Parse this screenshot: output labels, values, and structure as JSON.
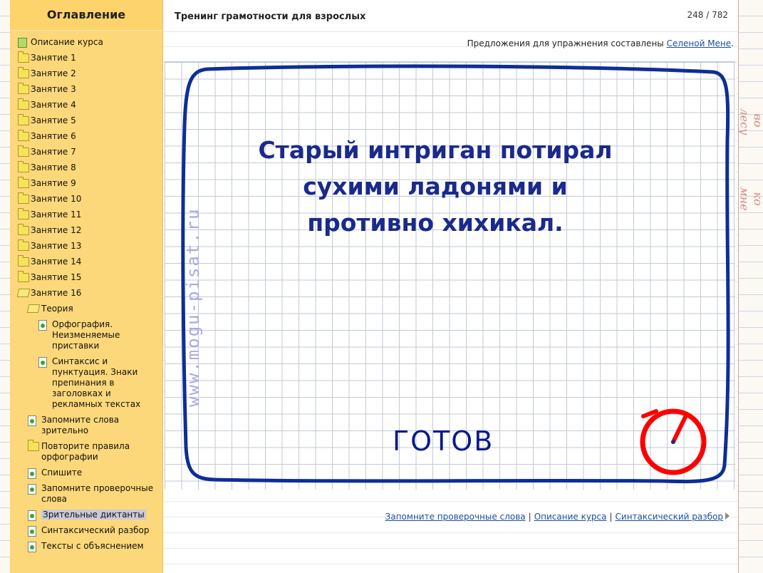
{
  "sidebar": {
    "title": "Оглавление",
    "items": [
      {
        "label": "Описание курса",
        "icon": "course-icon",
        "level": 1
      },
      {
        "label": "Занятие 1",
        "icon": "folder-icon",
        "level": 1
      },
      {
        "label": "Занятие 2",
        "icon": "folder-icon",
        "level": 1
      },
      {
        "label": "Занятие 3",
        "icon": "folder-icon",
        "level": 1
      },
      {
        "label": "Занятие 4",
        "icon": "folder-icon",
        "level": 1
      },
      {
        "label": "Занятие 5",
        "icon": "folder-icon",
        "level": 1
      },
      {
        "label": "Занятие 6",
        "icon": "folder-icon",
        "level": 1
      },
      {
        "label": "Занятие 7",
        "icon": "folder-icon",
        "level": 1
      },
      {
        "label": "Занятие 8",
        "icon": "folder-icon",
        "level": 1
      },
      {
        "label": "Занятие 9",
        "icon": "folder-icon",
        "level": 1
      },
      {
        "label": "Занятие 10",
        "icon": "folder-icon",
        "level": 1
      },
      {
        "label": "Занятие 11",
        "icon": "folder-icon",
        "level": 1
      },
      {
        "label": "Занятие 12",
        "icon": "folder-icon",
        "level": 1
      },
      {
        "label": "Занятие 13",
        "icon": "folder-icon",
        "level": 1
      },
      {
        "label": "Занятие 14",
        "icon": "folder-icon",
        "level": 1
      },
      {
        "label": "Занятие 15",
        "icon": "folder-icon",
        "level": 1
      },
      {
        "label": "Занятие 16",
        "icon": "folder-open-icon",
        "level": 1
      },
      {
        "label": "Теория",
        "icon": "folder-open-icon",
        "level": 2
      },
      {
        "label": "Орфография. Неизменяемые приставки",
        "icon": "doc-icon",
        "level": 3
      },
      {
        "label": "Синтаксис и пунктуация. Знаки препинания в заголовках и рекламных текстах",
        "icon": "doc-icon",
        "level": 3
      },
      {
        "label": "Запомните слова зрительно",
        "icon": "doc-icon",
        "level": 2
      },
      {
        "label": "Повторите правила орфографии",
        "icon": "folder-icon",
        "level": 2
      },
      {
        "label": "Спишите",
        "icon": "doc-icon",
        "level": 2
      },
      {
        "label": "Запомните проверочные слова",
        "icon": "doc-icon",
        "level": 2
      },
      {
        "label": "Зрительные диктанты",
        "icon": "doc-icon",
        "level": 2,
        "selected": true
      },
      {
        "label": "Синтаксический разбор",
        "icon": "doc-icon",
        "level": 2
      },
      {
        "label": "Тексты с объяснением",
        "icon": "doc-icon",
        "level": 2
      }
    ]
  },
  "header": {
    "title": "Тренинг грамотности для взрослых",
    "counter": "248 / 782"
  },
  "credits": {
    "text": "Предложения для упражнения составлены ",
    "link": "Селеной Мене",
    "suffix": "."
  },
  "slide": {
    "sentence": "Старый интриган потирал сухими ладонями и противно хихикал.",
    "watermark": "www.mogu-pisat.ru",
    "ready_label": "ГОТОВ",
    "frame_color": "#0e2e96",
    "clock_color": "#ff0000"
  },
  "footer": {
    "links": [
      "Запомните проверочные слова",
      "Описание курса",
      "Синтаксический разбор"
    ]
  },
  "background": {
    "right_scrawl_1": "во лесу",
    "right_scrawl_2": "ко мне"
  }
}
